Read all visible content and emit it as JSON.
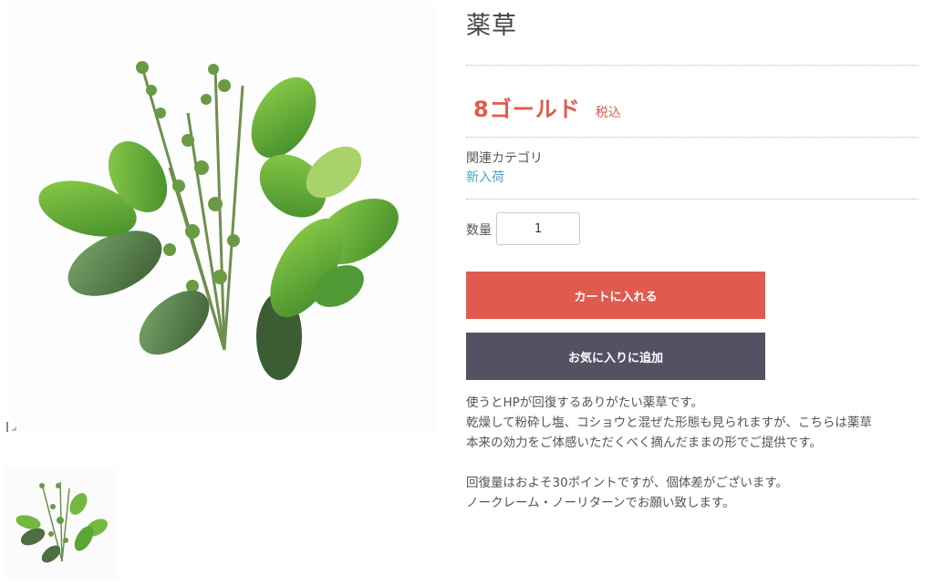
{
  "product": {
    "title": "薬草",
    "price": "8ゴールド",
    "tax_label": "税込",
    "category_label": "関連カテゴリ",
    "category_link": "新入荷",
    "quantity_label": "数量",
    "quantity_value": "1"
  },
  "buttons": {
    "add_to_cart": "カートに入れる",
    "add_to_favorites": "お気に入りに追加"
  },
  "description": {
    "line1": "使うとHPが回復するありがたい薬草です。",
    "line2": "乾燥して粉砕し塩、コショウと混ぜた形態も見られますが、こちらは薬草",
    "line3": "本来の効力をご体感いただくべく摘んだままの形でご提供です。",
    "line4": "回復量はおよそ30ポイントですが、個体差がございます。",
    "line5": "ノークレーム・ノーリターンでお願い致します。"
  },
  "colors": {
    "accent": "#e05a4e",
    "secondary_button": "#525263",
    "link": "#4aa3c6"
  },
  "icons": {
    "lightbox": "expand-icon"
  }
}
